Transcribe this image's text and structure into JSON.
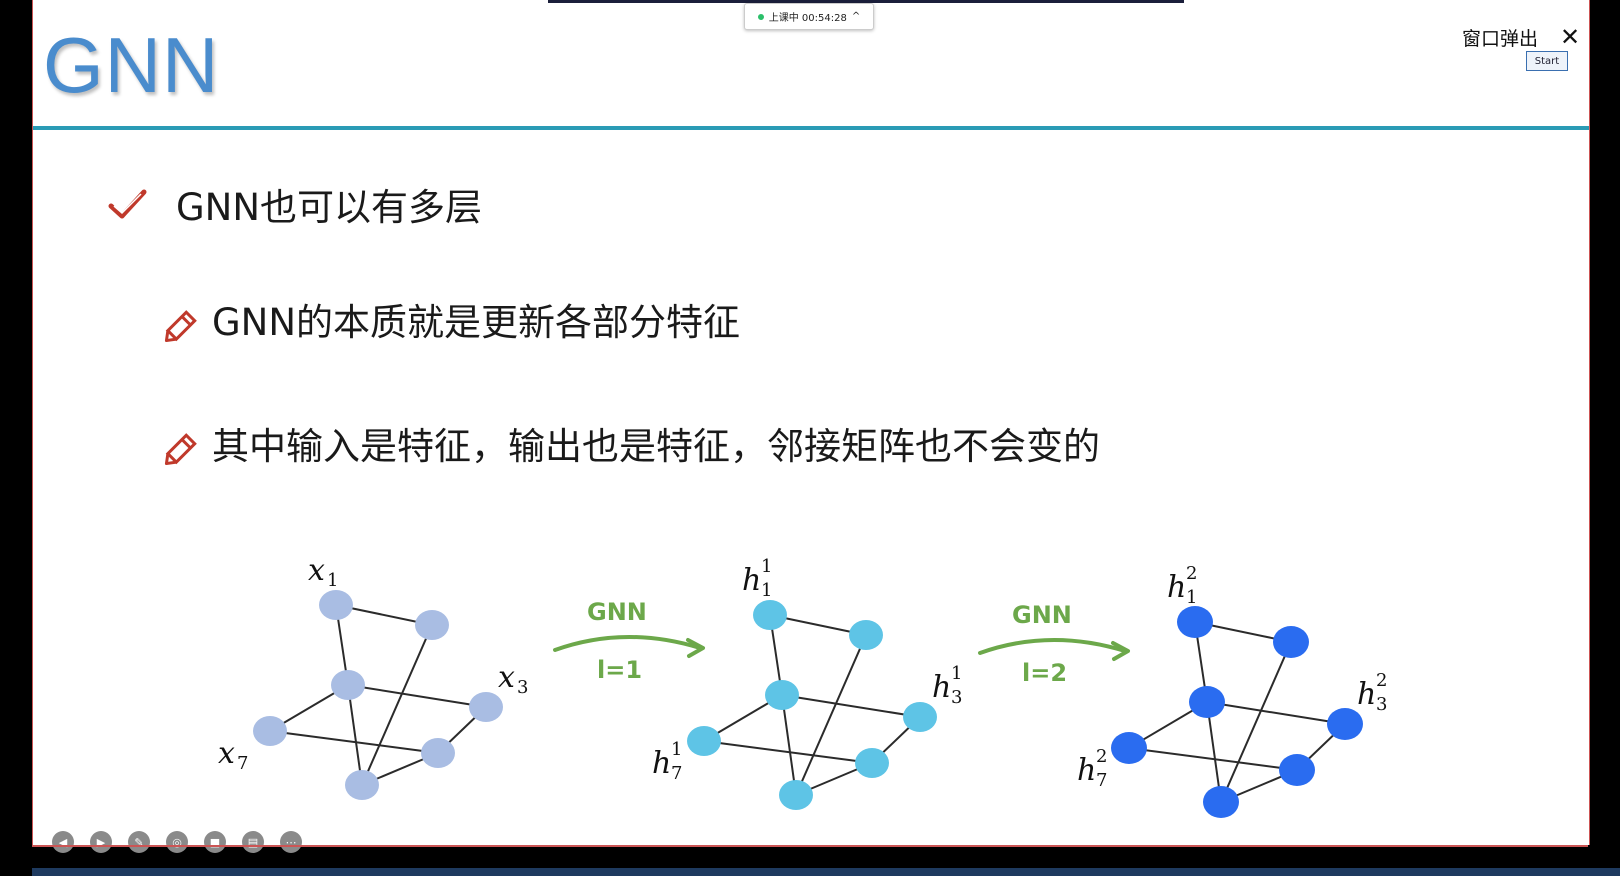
{
  "timer": {
    "label": "上课中 00:54:28"
  },
  "popout": {
    "label": "窗口弹出",
    "close_glyph": "✕"
  },
  "start_button": {
    "label": "Start"
  },
  "slide": {
    "title": "GNN",
    "bullets": [
      {
        "text": "GNN也可以有多层",
        "icon": "checkmark-icon"
      },
      {
        "text": "GNN的本质就是更新各部分特征",
        "icon": "pencil-icon"
      },
      {
        "text": "其中输入是特征，输出也是特征，邻接矩阵也不会变的",
        "icon": "pencil-icon"
      }
    ]
  },
  "diagram": {
    "graphs": [
      {
        "node_color": "#a9bde3",
        "labels": {
          "n1": "x",
          "n1_sub": "1",
          "n3": "x",
          "n3_sub": "3",
          "n7": "x",
          "n7_sub": "7"
        }
      },
      {
        "node_color": "#5ec4e6",
        "labels": {
          "n1": "h",
          "n1_sub": "1",
          "n1_sup": "1",
          "n3": "h",
          "n3_sub": "3",
          "n3_sup": "1",
          "n7": "h",
          "n7_sub": "7",
          "n7_sup": "1"
        }
      },
      {
        "node_color": "#2a6cf0",
        "labels": {
          "n1": "h",
          "n1_sub": "1",
          "n1_sup": "2",
          "n3": "h",
          "n3_sub": "3",
          "n3_sup": "2",
          "n7": "h",
          "n7_sub": "7",
          "n7_sup": "2"
        }
      }
    ],
    "arrows": [
      {
        "top": "GNN",
        "bottom": "l=1"
      },
      {
        "top": "GNN",
        "bottom": "l=2"
      }
    ],
    "arrow_color": "#6ca84a"
  },
  "toolbar": {
    "icons": [
      "prev-icon",
      "next-icon",
      "pen-icon",
      "screenshot-icon",
      "camera-icon",
      "chat-icon",
      "more-icon"
    ]
  }
}
